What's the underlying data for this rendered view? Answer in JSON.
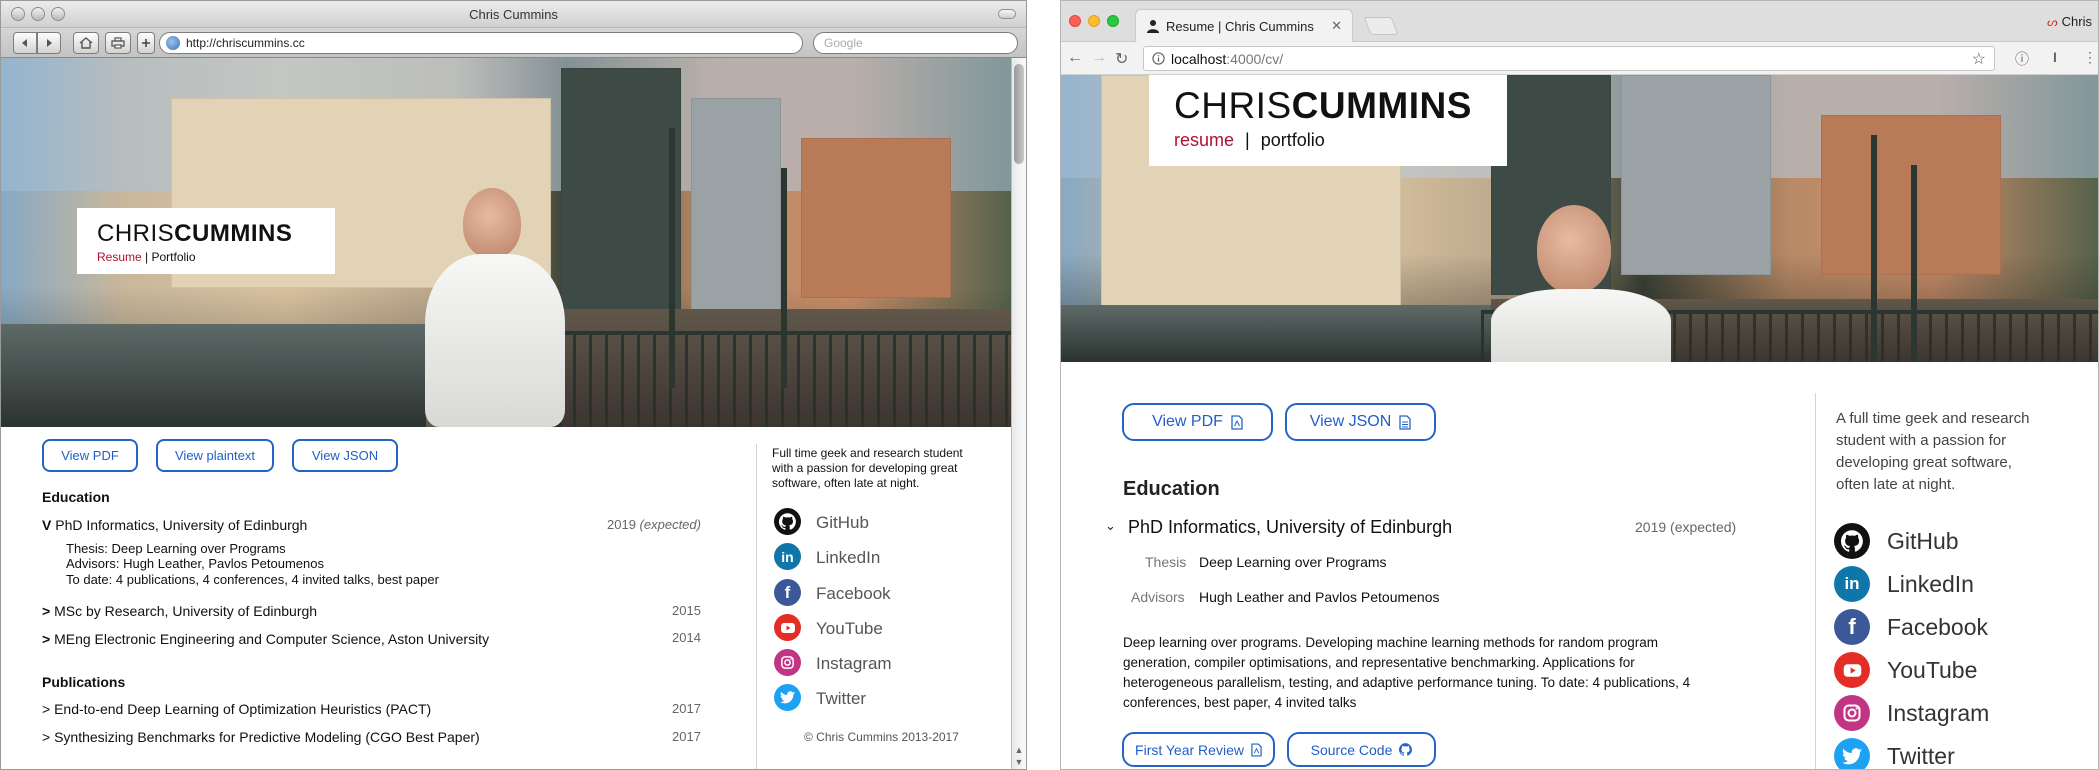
{
  "left": {
    "window_title": "Chris Cummins",
    "url": "http://chriscummins.cc",
    "search_placeholder": "Google",
    "brand": {
      "first": "CHRIS",
      "last": "CUMMINS"
    },
    "nav": {
      "resume": "Resume",
      "separator": "|",
      "portfolio": "Portfolio"
    },
    "buttons": {
      "pdf": "View PDF",
      "plaintext": "View plaintext",
      "json": "View JSON"
    },
    "education_heading": "Education",
    "education": [
      {
        "marker": "V",
        "title": "PhD Informatics, University of Edinburgh",
        "year": "2019",
        "year_note": "(expected)"
      },
      {
        "marker": ">",
        "title": "MSc by Research, University of Edinburgh",
        "year": "2015"
      },
      {
        "marker": ">",
        "title": "MEng Electronic Engineering and Computer Science, Aston University",
        "year": "2014"
      }
    ],
    "phd_details": {
      "thesis": "Thesis: Deep Learning over Programs",
      "advisors": "Advisors: Hugh Leather, Pavlos Petoumenos",
      "todate": "To date: 4 publications, 4 conferences, 4 invited talks, best paper"
    },
    "publications_heading": "Publications",
    "publications": [
      {
        "title": "> End-to-end Deep Learning of Optimization Heuristics (PACT)",
        "year": "2017"
      },
      {
        "title": "> Synthesizing Benchmarks for Predictive Modeling (CGO Best Paper)",
        "year": "2017"
      }
    ],
    "bio": [
      "Full time geek and research student",
      "with a passion for developing great",
      "software, often late at night."
    ],
    "social": [
      "GitHub",
      "LinkedIn",
      "Facebook",
      "YouTube",
      "Instagram",
      "Twitter"
    ],
    "copyright": "© Chris Cummins 2013-2017"
  },
  "right": {
    "tab_title": "Resume | Chris Cummins",
    "profile": "Chris",
    "url_host": "localhost",
    "url_path": ":4000/cv/",
    "brand": {
      "first": "CHRIS",
      "last": "CUMMINS"
    },
    "nav": {
      "resume": "resume",
      "separator": "|",
      "portfolio": "portfolio"
    },
    "buttons": {
      "pdf": "View PDF",
      "json": "View JSON"
    },
    "education_heading": "Education",
    "phd": {
      "title": "PhD Informatics, University of Edinburgh",
      "year": "2019 (expected)"
    },
    "thesis_label": "Thesis",
    "thesis_value": "Deep Learning over Programs",
    "advisors_label": "Advisors",
    "advisors_value": "Hugh Leather and Pavlos Petoumenos",
    "description": [
      "Deep learning over programs. Developing machine learning methods for random program",
      "generation, compiler optimisations, and representative benchmarking. Applications for",
      "heterogeneous parallelism, testing, and adaptive performance tuning. To date: 4 publications, 4",
      "conferences, best paper, 4 invited talks"
    ],
    "buttons2": {
      "review": "First Year Review",
      "source": "Source Code"
    },
    "bio": [
      "A full time geek and research",
      "student with a passion for",
      "developing great software,",
      "often late at night."
    ],
    "social": [
      "GitHub",
      "LinkedIn",
      "Facebook",
      "YouTube",
      "Instagram",
      "Twitter"
    ]
  },
  "colors": {
    "accent_blue": "#2563c9",
    "brand_red": "#b2102f",
    "github": "#111111",
    "linkedin": "#0e76a8",
    "facebook": "#3b5998",
    "youtube": "#e52d27",
    "instagram": "#c13584",
    "twitter": "#1da1f2"
  }
}
